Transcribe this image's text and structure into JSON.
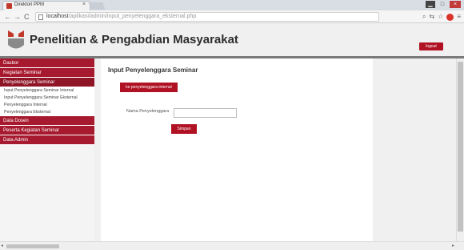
{
  "browser": {
    "tab_title": "Direktori PPM",
    "url_host": "localhost",
    "url_path": "/aplikasi/admin/input_penyelenggara_eksternal.php"
  },
  "header": {
    "site_title": "Penelitian & Pengabdian Masyarakat",
    "logout_label": "logout"
  },
  "sidebar": {
    "items": [
      {
        "label": "Dasbor"
      },
      {
        "label": "Kegiatan Seminar"
      },
      {
        "label": "Penyelenggara Seminar"
      }
    ],
    "subitems": [
      {
        "label": "Input Penyelenggara Seminar Internal"
      },
      {
        "label": "Input Penyelenggara Seminar Eksternal"
      },
      {
        "label": "Penyelenggara Internal"
      },
      {
        "label": "Penyelenggara Eksternal"
      }
    ],
    "items_after": [
      {
        "label": "Data Dosen"
      },
      {
        "label": "Peserta Kegiatan Seminar"
      },
      {
        "label": "Data Admin"
      }
    ]
  },
  "main": {
    "title": "Input Penyelenggara Seminar",
    "switch_button": "ke penyelenggara internal",
    "field_label": "Nama Penyelenggara",
    "field_value": "",
    "submit_label": "Simpan"
  },
  "colors": {
    "accent": "#b01224",
    "menu": "#a6192e"
  }
}
